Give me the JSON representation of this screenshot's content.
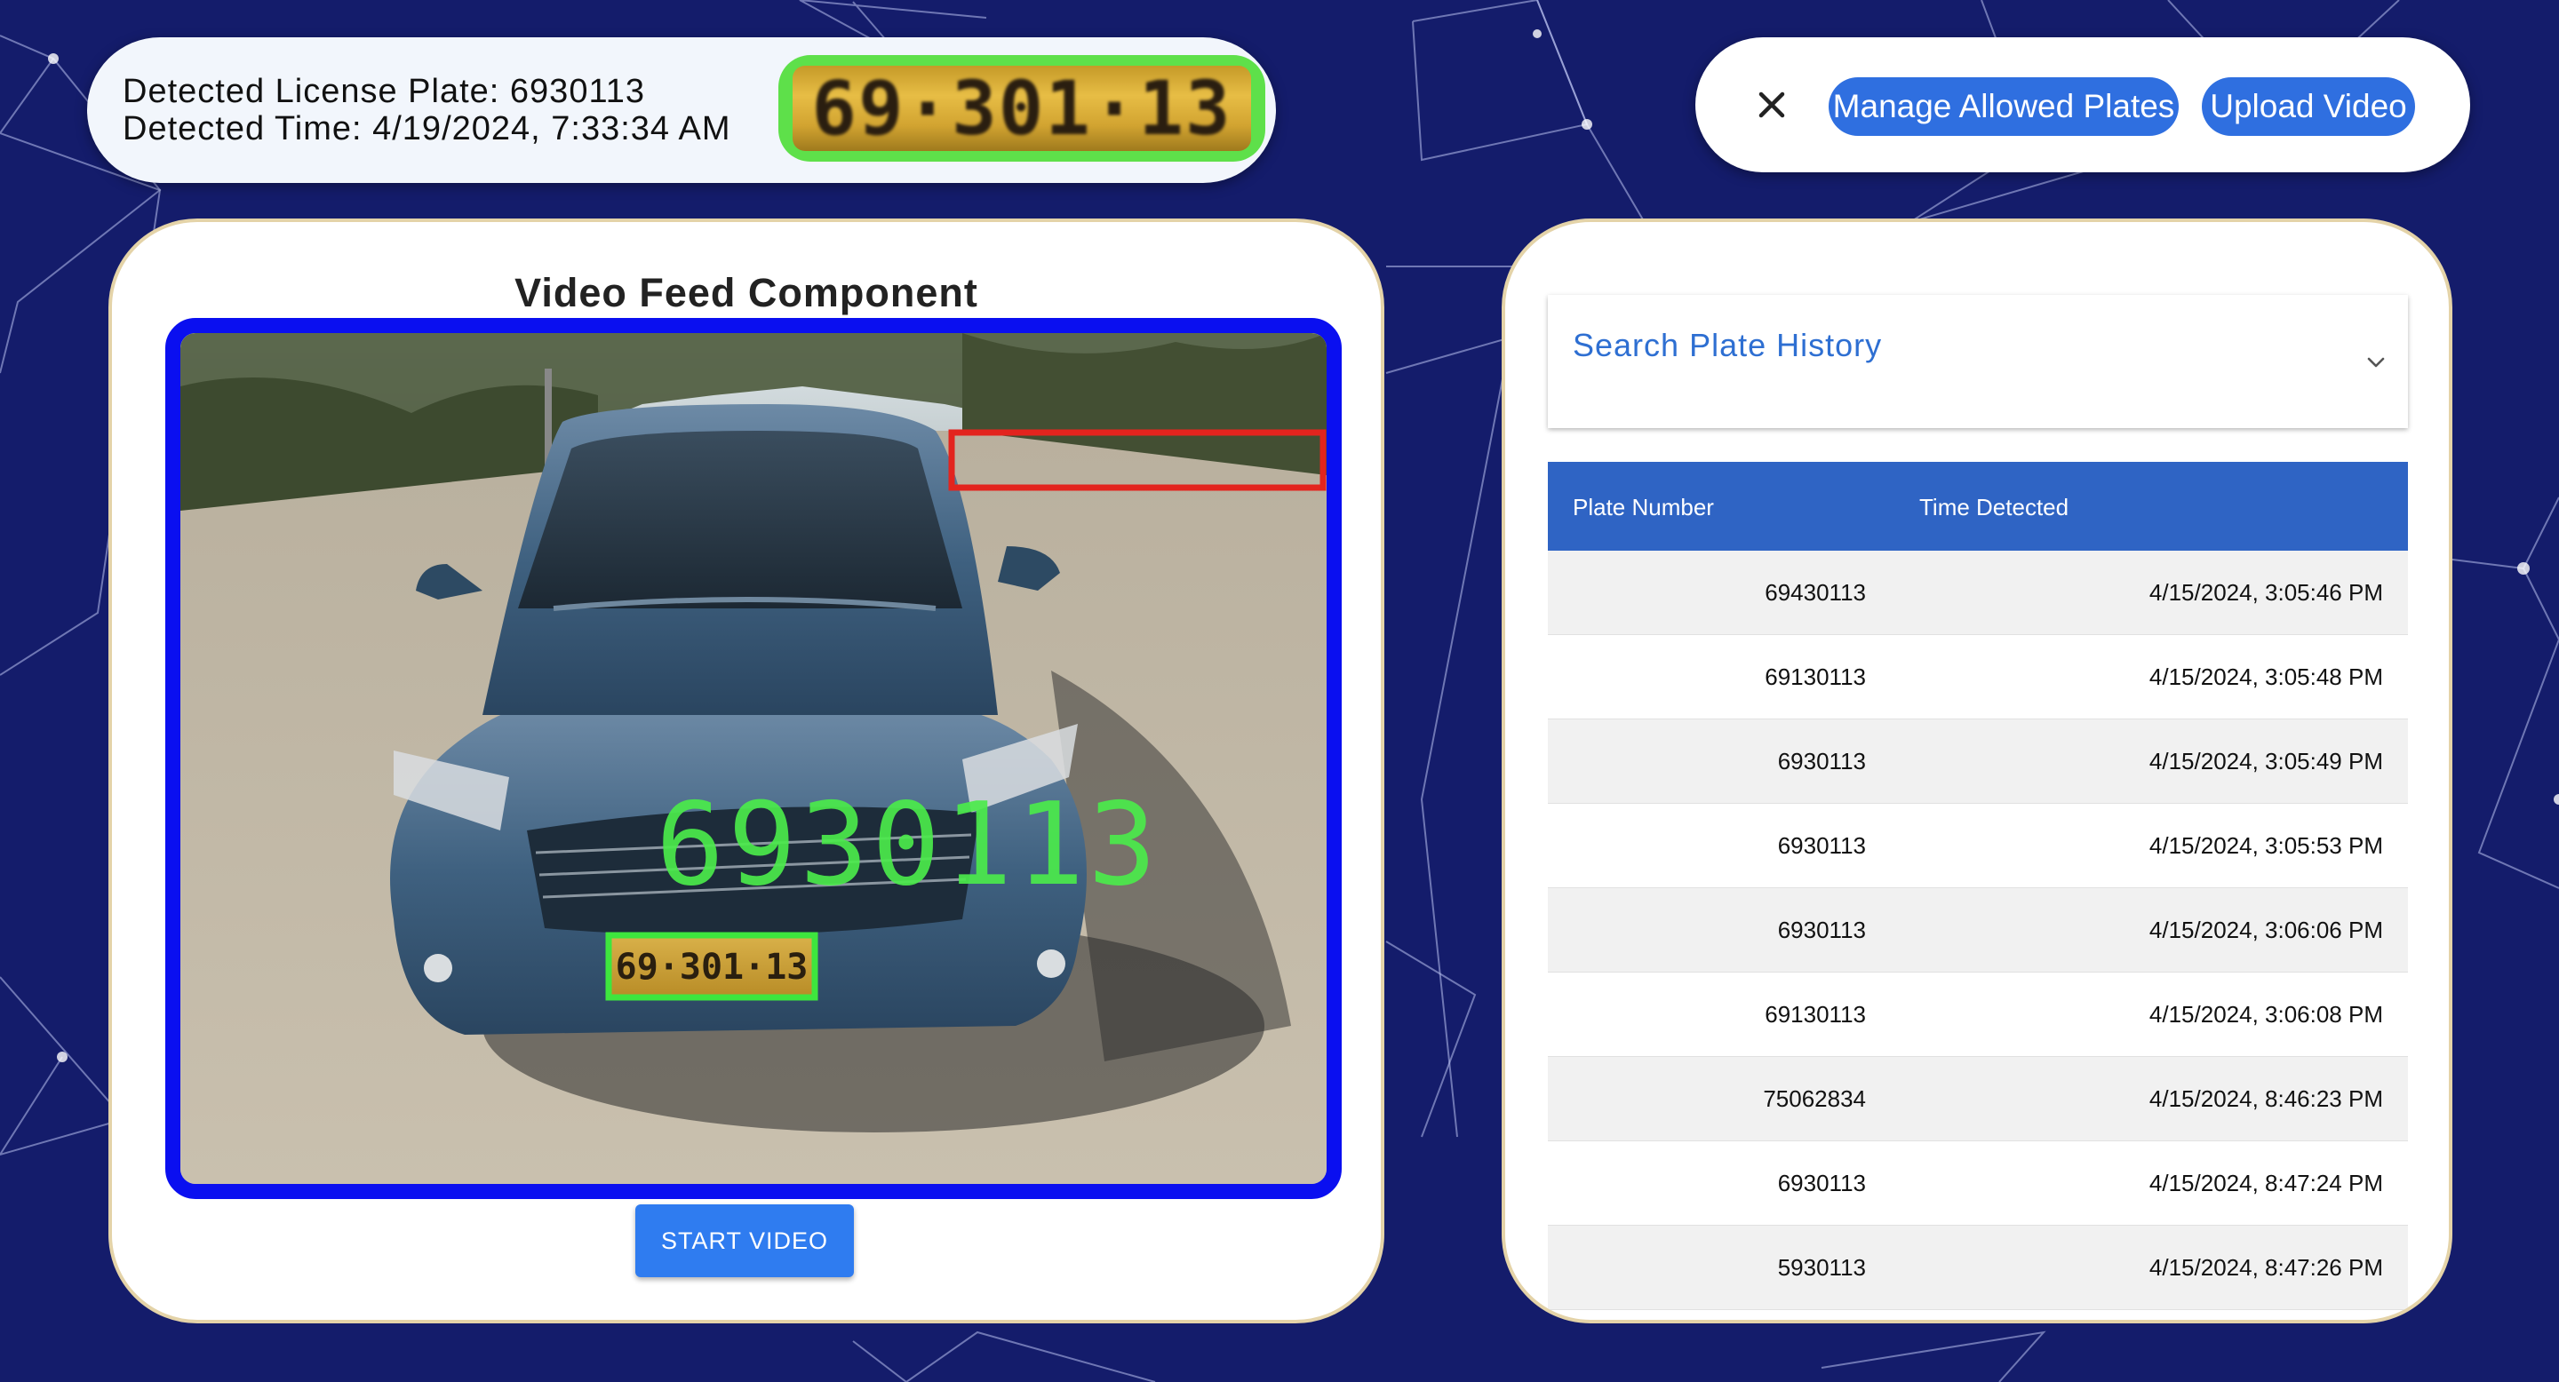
{
  "detection": {
    "plate_line": "Detected License Plate: 6930113",
    "time_line": "Detected Time: 4/19/2024, 7:33:34 AM",
    "plate_image_text": "69·301·13"
  },
  "actions": {
    "close_icon": "close-icon",
    "manage_label": "Manage Allowed Plates",
    "upload_label": "Upload Video"
  },
  "video": {
    "title": "Video Feed Component",
    "overlay_plate": "6930113",
    "car_plate_text": "69·301·13",
    "start_label": "START VIDEO"
  },
  "history": {
    "search_label": "Search Plate History",
    "columns": [
      "Plate Number",
      "Time Detected"
    ],
    "rows": [
      {
        "plate": "69430113",
        "time": "4/15/2024, 3:05:46 PM"
      },
      {
        "plate": "69130113",
        "time": "4/15/2024, 3:05:48 PM"
      },
      {
        "plate": "6930113",
        "time": "4/15/2024, 3:05:49 PM"
      },
      {
        "plate": "6930113",
        "time": "4/15/2024, 3:05:53 PM"
      },
      {
        "plate": "6930113",
        "time": "4/15/2024, 3:06:06 PM"
      },
      {
        "plate": "69130113",
        "time": "4/15/2024, 3:06:08 PM"
      },
      {
        "plate": "75062834",
        "time": "4/15/2024, 8:46:23 PM"
      },
      {
        "plate": "6930113",
        "time": "4/15/2024, 8:47:24 PM"
      },
      {
        "plate": "5930113",
        "time": "4/15/2024, 8:47:26 PM"
      }
    ]
  },
  "colors": {
    "background": "#141c6b",
    "accent": "#2f6fe0",
    "detection_box": "#4be04b",
    "feed_border": "#0a0ff0"
  }
}
